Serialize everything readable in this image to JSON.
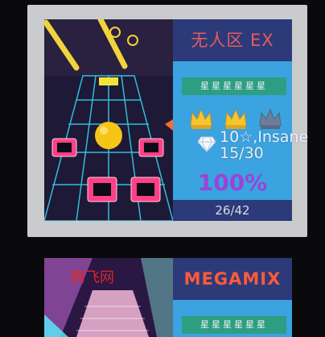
{
  "level1": {
    "title": "无人区 EX",
    "star_rating_text": "星星星星星星",
    "crowns": [
      "gold",
      "gold",
      "gray"
    ],
    "stars_label": "10☆,Insane",
    "progress_fraction": "15/30",
    "percent": "100%",
    "level_index": "26/42",
    "colors": {
      "panel_bg": "#3aa3e0",
      "head_bg": "#2d3a79",
      "stars_bg": "#2d9e82",
      "title": "#e85b5b",
      "percent": "#9b43d8"
    }
  },
  "level2": {
    "title": "MEGAMIX",
    "star_rating_text": "星星星星星星",
    "colors": {
      "title": "#ff5a3a"
    }
  },
  "watermark": "腾飞网",
  "icons": [
    "gold-crown-icon",
    "gray-crown-icon",
    "diamond-icon"
  ]
}
